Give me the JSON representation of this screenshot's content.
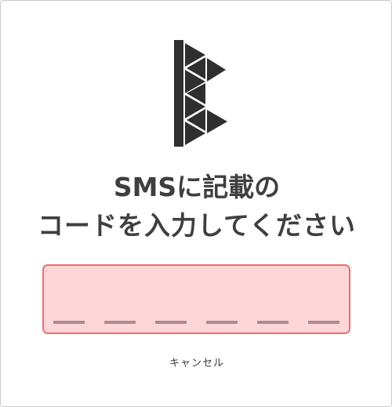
{
  "header": {
    "logo_icon": "triangle-b-logo-icon",
    "title_line1": "SMSに記載の",
    "title_line2": "コードを入力してください"
  },
  "code_input": {
    "value": "",
    "digits": 6,
    "background_color": "#ffd6d7",
    "border_color": "#ee6f6f",
    "slot_color": "#a98d92"
  },
  "actions": {
    "cancel_label": "キャンセル"
  }
}
